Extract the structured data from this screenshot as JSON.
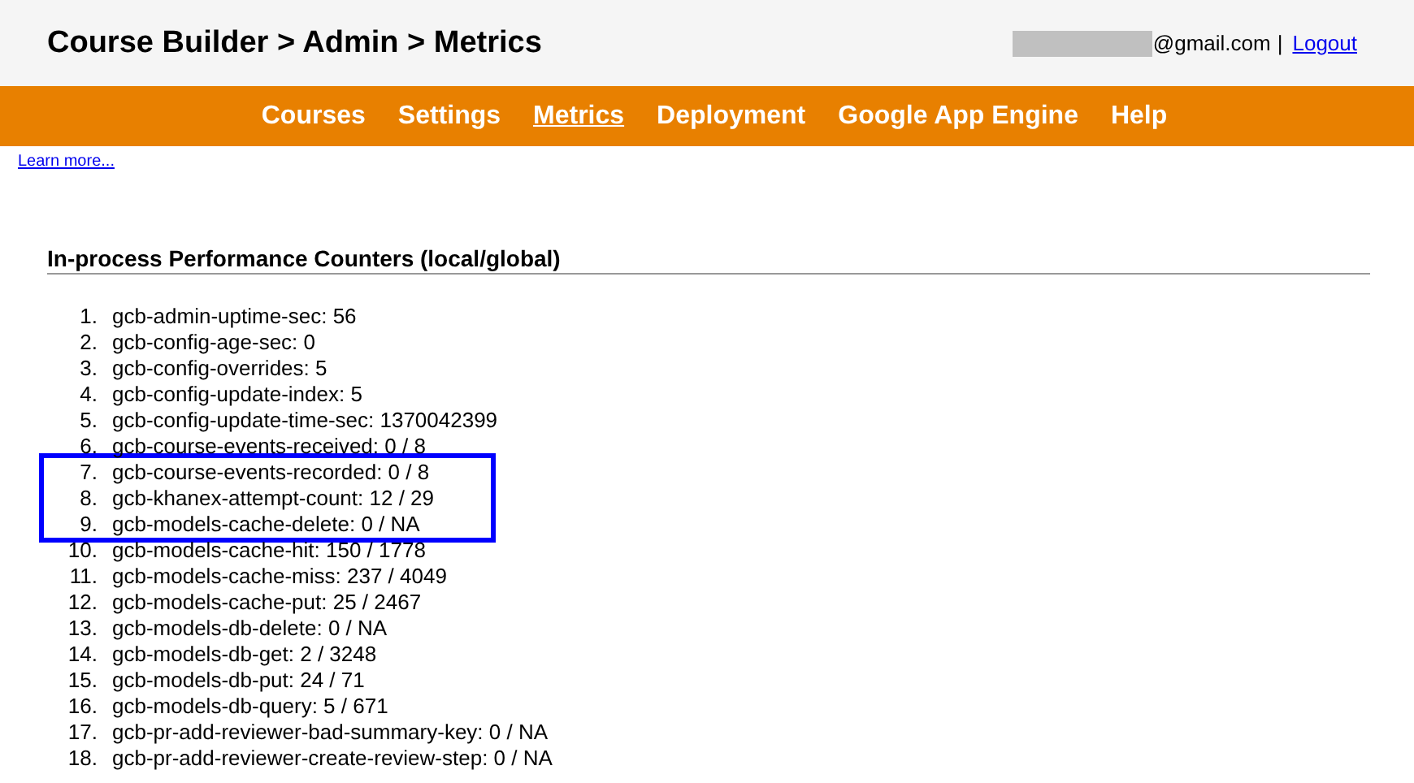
{
  "header": {
    "title": "Course Builder > Admin > Metrics",
    "user": {
      "email": "@gmail.com",
      "separator": "|",
      "logout": "Logout"
    }
  },
  "nav": [
    {
      "label": "Courses",
      "selected": false
    },
    {
      "label": "Settings",
      "selected": false
    },
    {
      "label": "Metrics",
      "selected": true
    },
    {
      "label": "Deployment",
      "selected": false
    },
    {
      "label": "Google App Engine",
      "selected": false
    },
    {
      "label": "Help",
      "selected": false
    }
  ],
  "learn_more": "Learn more...",
  "section": {
    "title": "In-process Performance Counters (local/global)",
    "counters": [
      {
        "number": "1.",
        "text": "gcb-admin-uptime-sec: 56",
        "highlighted": false
      },
      {
        "number": "2.",
        "text": "gcb-config-age-sec: 0",
        "highlighted": false
      },
      {
        "number": "3.",
        "text": "gcb-config-overrides: 5",
        "highlighted": false
      },
      {
        "number": "4.",
        "text": "gcb-config-update-index: 5",
        "highlighted": false
      },
      {
        "number": "5.",
        "text": "gcb-config-update-time-sec: 1370042399",
        "highlighted": false
      },
      {
        "number": "6.",
        "text": "gcb-course-events-received: 0 / 8",
        "highlighted": false
      },
      {
        "number": "7.",
        "text": "gcb-course-events-recorded: 0 / 8",
        "highlighted": true
      },
      {
        "number": "8.",
        "text": "gcb-khanex-attempt-count: 12 / 29",
        "highlighted": true
      },
      {
        "number": "9.",
        "text": "gcb-models-cache-delete: 0 / NA",
        "highlighted": true
      },
      {
        "number": "10.",
        "text": "gcb-models-cache-hit: 150 / 1778",
        "highlighted": false
      },
      {
        "number": "11.",
        "text": "gcb-models-cache-miss: 237 / 4049",
        "highlighted": false
      },
      {
        "number": "12.",
        "text": "gcb-models-cache-put: 25 / 2467",
        "highlighted": false
      },
      {
        "number": "13.",
        "text": "gcb-models-db-delete: 0 / NA",
        "highlighted": false
      },
      {
        "number": "14.",
        "text": "gcb-models-db-get: 2 / 3248",
        "highlighted": false
      },
      {
        "number": "15.",
        "text": "gcb-models-db-put: 24 / 71",
        "highlighted": false
      },
      {
        "number": "16.",
        "text": "gcb-models-db-query: 5 / 671",
        "highlighted": false
      },
      {
        "number": "17.",
        "text": "gcb-pr-add-reviewer-bad-summary-key: 0 / NA",
        "highlighted": false
      },
      {
        "number": "18.",
        "text": "gcb-pr-add-reviewer-create-review-step: 0 / NA",
        "highlighted": false
      }
    ]
  }
}
